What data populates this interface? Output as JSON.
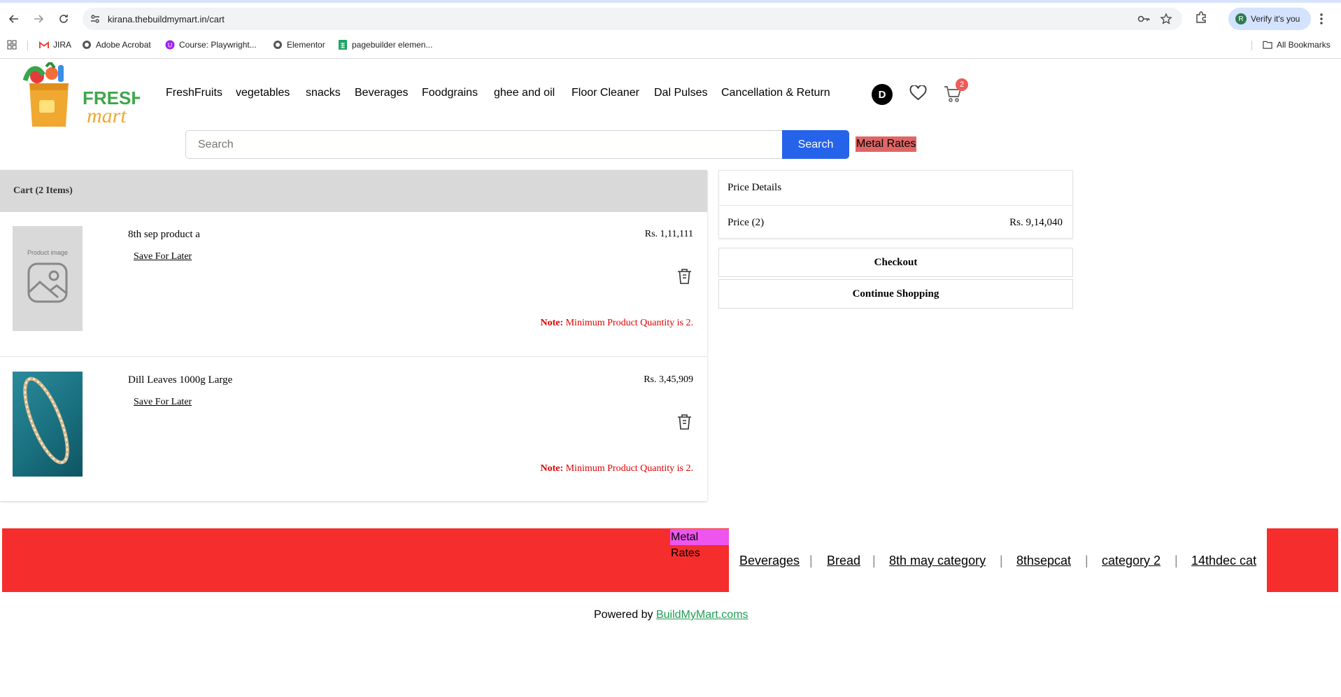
{
  "browser": {
    "url": "kirana.thebuildmymart.in/cart",
    "profile_label": "Verify it's you",
    "profile_initial": "R",
    "bookmarks": [
      "JIRA",
      "Adobe Acrobat",
      "Course: Playwright...",
      "Elementor",
      "pagebuilder elemen..."
    ],
    "all_bookmarks": "All Bookmarks"
  },
  "header": {
    "logo_word1": "FRESH",
    "logo_word2": "mart",
    "nav": [
      "FreshFruits",
      "vegetables",
      "snacks",
      "Beverages",
      "Foodgrains",
      "ghee and oil",
      "Floor Cleaner",
      "Dal Pulses",
      "Cancellation & Return"
    ],
    "user_initial": "D",
    "cart_count": "2",
    "search_placeholder": "Search",
    "search_button": "Search",
    "metal_rates": "Metal Rates"
  },
  "cart": {
    "title": "Cart (2 Items)",
    "items": [
      {
        "name": "8th sep product a",
        "price": "Rs. 1,11,111",
        "save_for_later": "Save For Later",
        "note_label": "Note:",
        "note_text": "Minimum Product Quantity is 2.",
        "image_placeholder": "Product image"
      },
      {
        "name": "Dill Leaves 1000g Large",
        "price": "Rs. 3,45,909",
        "save_for_later": "Save For Later",
        "note_label": "Note:",
        "note_text": "Minimum Product Quantity is 2."
      }
    ]
  },
  "price_details": {
    "title": "Price Details",
    "price_label": "Price (2)",
    "price_value": "Rs. 9,14,040",
    "checkout": "Checkout",
    "continue": "Continue Shopping"
  },
  "footer": {
    "metal_rates": "Metal Rates",
    "links": [
      "Beverages",
      "Bread",
      "8th may category",
      "8thsepcat",
      "category 2",
      "14thdec cat"
    ],
    "separator": "|",
    "powered_prefix": "Powered by",
    "powered_link": "BuildMyMart.coms"
  },
  "colors": {
    "search_button": "#2563eb",
    "footer_red": "#f52d2d",
    "metal_rates_top": "#e06666",
    "metal_rates_footer": "#ee55ee",
    "note_red": "#e00000",
    "powered_link": "#1f9d55"
  }
}
